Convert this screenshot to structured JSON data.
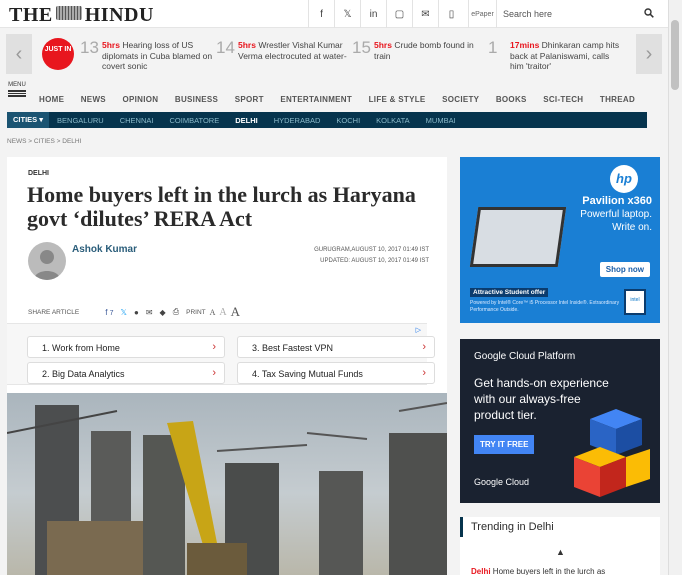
{
  "header": {
    "logo": "THE HINDU",
    "social_icons": [
      "facebook-icon",
      "twitter-icon",
      "linkedin-icon",
      "instagram-icon",
      "mail-icon",
      "mobile-icon"
    ],
    "epaper_label": "ePaper",
    "search_placeholder": "Search here"
  },
  "ticker": {
    "badge": "JUST IN",
    "items": [
      {
        "num": "13",
        "time": "5hrs",
        "text": "Hearing loss of US diplomats in Cuba blamed on covert sonic"
      },
      {
        "num": "14",
        "time": "5hrs",
        "text": "Wrestler Vishal Kumar Verma electrocuted at water-"
      },
      {
        "num": "15",
        "time": "5hrs",
        "text": "Crude bomb found in train"
      },
      {
        "num": "1",
        "time": "17mins",
        "text": "Dhinkaran camp hits back at Palaniswami, calls him 'traitor'"
      }
    ]
  },
  "menu_label": "MENU",
  "nav": [
    "HOME",
    "NEWS",
    "OPINION",
    "BUSINESS",
    "SPORT",
    "ENTERTAINMENT",
    "LIFE & STYLE",
    "SOCIETY",
    "BOOKS",
    "SCI-TECH",
    "THREAD"
  ],
  "cities": {
    "label": "CITIES",
    "items": [
      "BENGALURU",
      "CHENNAI",
      "COIMBATORE",
      "DELHI",
      "HYDERABAD",
      "KOCHI",
      "KOLKATA",
      "MUMBAI"
    ],
    "active": "DELHI"
  },
  "breadcrumb": "NEWS > CITIES > DELHI",
  "article": {
    "kicker": "DELHI",
    "headline": "Home buyers left in the lurch as Haryana govt ‘dilutes’ RERA Act",
    "author": "Ashok Kumar",
    "dateline": "GURUGRAM,AUGUST 10, 2017 01:49 IST",
    "updated": "UPDATED: AUGUST 10, 2017 01:49 IST",
    "share_label": "SHARE ARTICLE",
    "share_count": "7",
    "print_label": "PRINT",
    "font_sizes": [
      "A",
      "A",
      "A"
    ]
  },
  "ad_links": [
    {
      "text": "1.  Work from Home"
    },
    {
      "text": "3.  Best Fastest VPN"
    },
    {
      "text": "2.  Big Data Analytics"
    },
    {
      "text": "4.  Tax Saving Mutual Funds"
    }
  ],
  "hp_ad": {
    "model": "Pavilion x360",
    "line1": "Powerful laptop.",
    "line2": "Write on.",
    "cta": "Shop now",
    "offer": "Attractive Student offer",
    "fine_print": "Powered by Intel® Core™ i5 Processor Intel Inside®. Extraordinary Performance Outside.",
    "logo": "hp",
    "intel_label": "intel"
  },
  "gcp_ad": {
    "brand": "Google Cloud Platform",
    "copy": "Get hands-on experience with our always-free product tier.",
    "cta": "TRY IT FREE",
    "footer": "Google Cloud"
  },
  "trending": {
    "title": "Trending in Delhi",
    "item_tag": "Delhi",
    "item_text": "Home buyers left in the lurch as"
  }
}
